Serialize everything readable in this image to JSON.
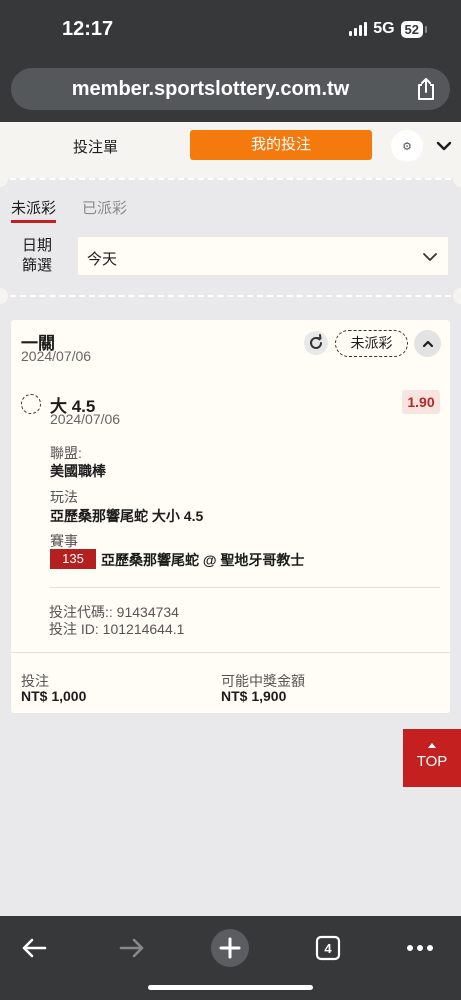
{
  "status_bar": {
    "time": "12:17",
    "network": "5G",
    "battery": "52"
  },
  "browser": {
    "url": "member.sportslottery.com.tw"
  },
  "header": {
    "tab_slip": "投注單",
    "tab_mybets": "我的投注"
  },
  "subtabs": {
    "unsettled": "未派彩",
    "settled": "已派彩"
  },
  "filter": {
    "label": "日期篩選",
    "value": "今天"
  },
  "bet": {
    "type": "一關",
    "date": "2024/07/06",
    "status": "未派彩",
    "selection": {
      "name": "大 4.5",
      "date": "2024/07/06",
      "odds": "1.90"
    },
    "league_label": "聯盟:",
    "league": "美國職棒",
    "market_label": "玩法",
    "market": "亞歷桑那響尾蛇 大小 4.5",
    "event_label": "賽事",
    "event_number": "135",
    "event": "亞歷桑那響尾蛇 @ 聖地牙哥教士",
    "code": "投注代碼:: 91434734",
    "bet_id": "投注 ID: 101214644.1",
    "stake_label": "投注",
    "stake": "NT$ 1,000",
    "payout_label": "可能中獎金額",
    "payout": "NT$ 1,900"
  },
  "top_button": "TOP",
  "toolbar": {
    "tabs_count": "4"
  },
  "colors": {
    "brand_orange": "#f57a0d",
    "brand_red": "#c4201f",
    "card_bg": "#fffdf6"
  }
}
